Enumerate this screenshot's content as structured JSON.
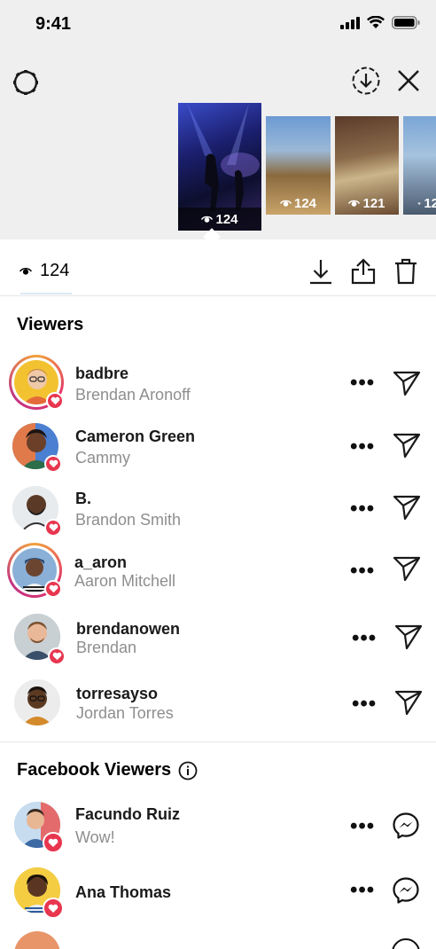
{
  "status": {
    "time": "9:41"
  },
  "thumbnails": [
    {
      "views": "124"
    },
    {
      "views": "124"
    },
    {
      "views": "121"
    },
    {
      "views": "12"
    }
  ],
  "toolbar": {
    "views": "124"
  },
  "viewers": {
    "title": "Viewers",
    "items": [
      {
        "username": "badbre",
        "name": "Brendan Aronoff"
      },
      {
        "username": "Cameron Green",
        "name": "Cammy"
      },
      {
        "username": "B.",
        "name": "Brandon Smith"
      },
      {
        "username": "a_aron",
        "name": "Aaron Mitchell"
      },
      {
        "username": "brendanowen",
        "name": "Brendan"
      },
      {
        "username": "torresayso",
        "name": "Jordan Torres"
      }
    ]
  },
  "facebook_viewers": {
    "title": "Facebook Viewers",
    "items": [
      {
        "username": "Facundo Ruiz",
        "name": "Wow!"
      },
      {
        "username": "Ana Thomas",
        "name": ""
      }
    ]
  },
  "more_label": "•••",
  "colors": {
    "heart": "#e8364f",
    "ring": "#e1306c",
    "muted": "#8e8e8e"
  }
}
